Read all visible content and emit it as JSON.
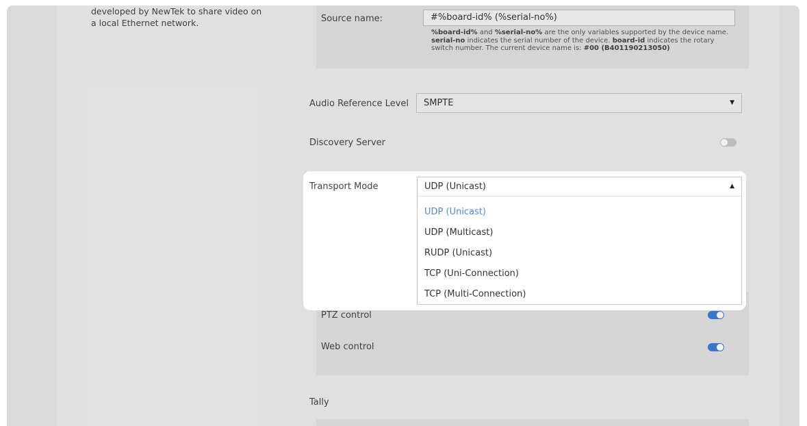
{
  "intro_text": "developed by NewTek to share video on a local Ethernet network.",
  "source": {
    "label": "Source name:",
    "value": "#%board-id% (%serial-no%)",
    "help_1": "%board-id%",
    "help_2": " and ",
    "help_3": "%serial-no%",
    "help_4": " are the only variables supported by the device name. ",
    "help_5": "serial-no",
    "help_6": " indicates the serial number of the device. ",
    "help_7": "board-id",
    "help_8": " indicates the rotary switch number. The current device name is: ",
    "help_9": "#00 (B401190213050)"
  },
  "audio": {
    "label": "Audio Reference Level",
    "value": "SMPTE"
  },
  "discovery": {
    "label": "Discovery Server",
    "enabled": false
  },
  "transport": {
    "label": "Transport Mode",
    "value": "UDP (Unicast)",
    "options": [
      {
        "label": "UDP (Unicast)",
        "selected": true
      },
      {
        "label": "UDP (Multicast)",
        "selected": false
      },
      {
        "label": "RUDP (Unicast)",
        "selected": false
      },
      {
        "label": "TCP (Uni-Connection)",
        "selected": false
      },
      {
        "label": "TCP (Multi-Connection)",
        "selected": false
      }
    ]
  },
  "ptz": {
    "label": "PTZ control",
    "enabled": true
  },
  "web": {
    "label": "Web control",
    "enabled": true
  },
  "tally": {
    "label": "Tally"
  },
  "colors": {
    "accent": "#3d7fd6",
    "selected_option": "#4a8ad8"
  },
  "icons": {
    "caret_down": "caret-down-icon",
    "caret_up": "caret-up-icon"
  }
}
